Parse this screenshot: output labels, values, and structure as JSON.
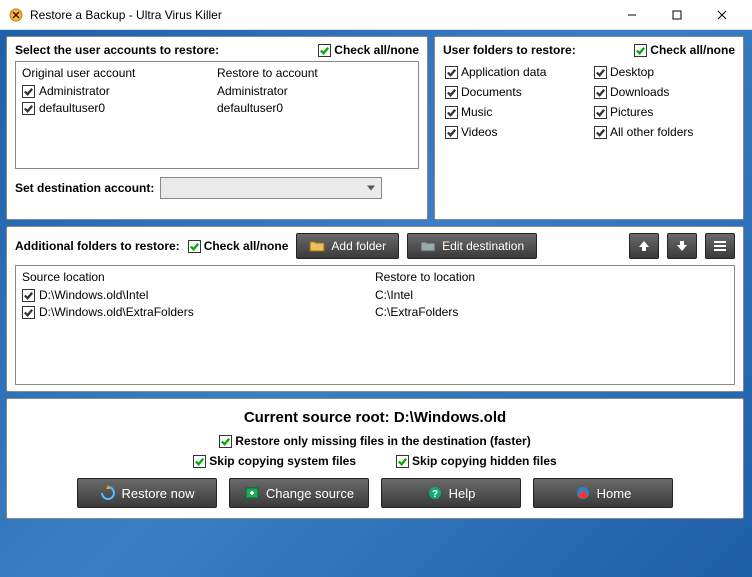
{
  "window": {
    "title": "Restore a Backup - Ultra Virus Killer"
  },
  "accounts": {
    "header": "Select the user accounts to restore:",
    "check_all": "Check all/none",
    "col1_header": "Original user account",
    "col2_header": "Restore to account",
    "rows": [
      {
        "original": "Administrator",
        "restore": "Administrator"
      },
      {
        "original": "defaultuser0",
        "restore": "defaultuser0"
      }
    ],
    "dest_label": "Set destination account:"
  },
  "userfolders": {
    "header": "User folders to restore:",
    "check_all": "Check all/none",
    "items": [
      "Application data",
      "Desktop",
      "Documents",
      "Downloads",
      "Music",
      "Pictures",
      "Videos",
      "All other folders"
    ]
  },
  "additional": {
    "header": "Additional folders to restore:",
    "check_all": "Check all/none",
    "add_folder": "Add folder",
    "edit_dest": "Edit destination",
    "col1_header": "Source location",
    "col2_header": "Restore to location",
    "rows": [
      {
        "src": "D:\\Windows.old\\Intel",
        "dst": "C:\\Intel"
      },
      {
        "src": "D:\\Windows.old\\ExtraFolders",
        "dst": "C:\\ExtraFolders"
      }
    ]
  },
  "bottom": {
    "source_label_prefix": "Current source root: ",
    "source_root": "D:\\Windows.old",
    "opt_missing": "Restore only missing files in the destination (faster)",
    "opt_system": "Skip copying system files",
    "opt_hidden": "Skip copying hidden files",
    "restore_now": "Restore now",
    "change_source": "Change source",
    "help": "Help",
    "home": "Home"
  }
}
